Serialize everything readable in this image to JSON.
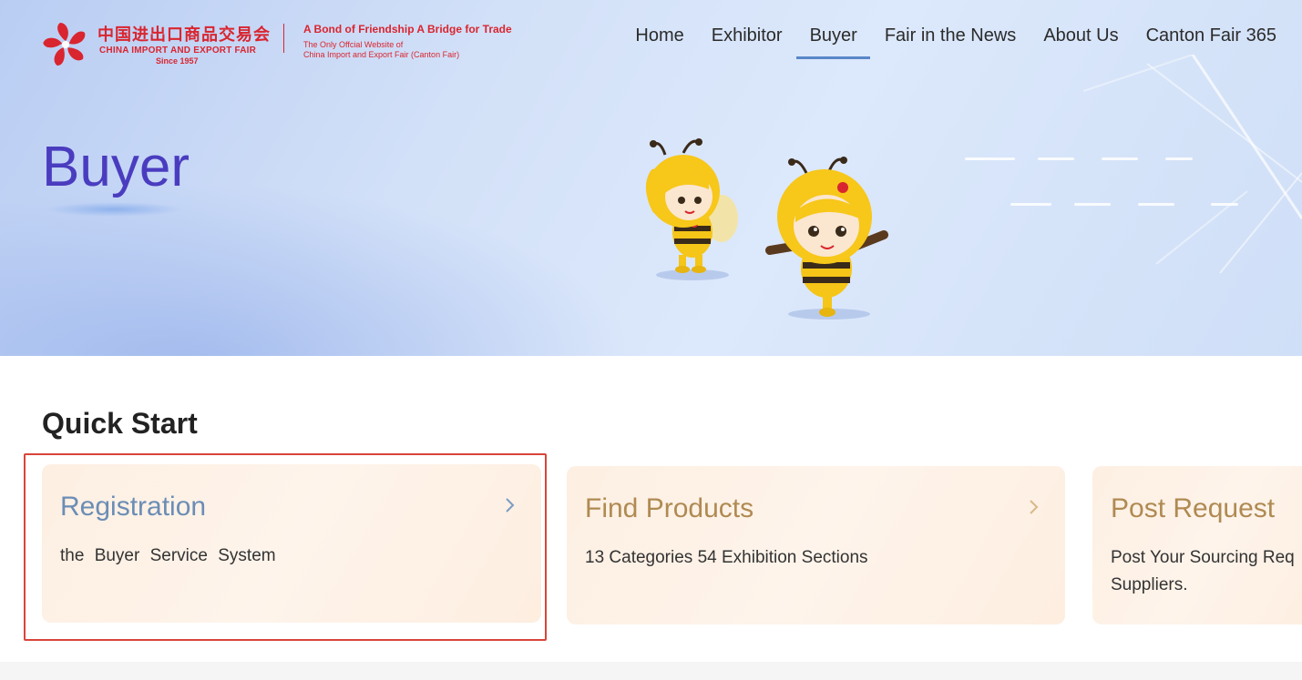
{
  "logo": {
    "chinese_name": "中国进出口商品交易会",
    "english_name": "CHINA IMPORT AND EXPORT FAIR",
    "since": "Since 1957",
    "slogan": "A Bond of Friendship  A Bridge for Trade",
    "sub_line1": "The Only Offcial Website of",
    "sub_line2": "China Import and Export Fair (Canton Fair)"
  },
  "nav": {
    "items": [
      {
        "label": "Home"
      },
      {
        "label": "Exhibitor"
      },
      {
        "label": "Buyer"
      },
      {
        "label": "Fair in the News"
      },
      {
        "label": "About Us"
      },
      {
        "label": "Canton Fair 365"
      }
    ],
    "active": "Buyer"
  },
  "hero": {
    "title": "Buyer"
  },
  "quick_start": {
    "title": "Quick Start",
    "cards": [
      {
        "title": "Registration",
        "desc": "the Buyer Service System",
        "icon": "chevron-right-icon"
      },
      {
        "title": "Find Products",
        "desc": "13 Categories 54 Exhibition Sections",
        "icon": "chevron-right-icon"
      },
      {
        "title": "Post Request",
        "desc": "Post Your Sourcing Req",
        "desc2": "Suppliers."
      }
    ]
  },
  "colors": {
    "brand_red": "#d9252f",
    "nav_active": "#5a86c8",
    "hero_title": "#4a3cbf",
    "card_title_blue": "#6b8db5",
    "card_title_gold": "#b08a52",
    "highlight_border": "#d9453a"
  }
}
